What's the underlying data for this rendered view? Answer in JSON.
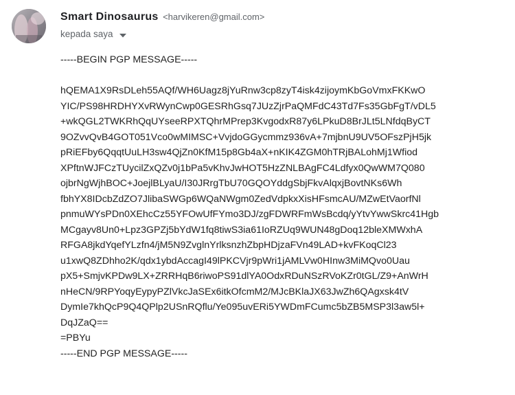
{
  "header": {
    "sender_name": "Smart Dinosaurus",
    "sender_email": "<harvikeren@gmail.com>",
    "recipient_label": "kepada saya",
    "avatar_icon": "user-photo-icon",
    "caret_icon": "caret-down-icon"
  },
  "message": {
    "begin_marker": "-----BEGIN PGP MESSAGE-----",
    "body_lines": [
      "hQEMA1X9RsDLeh55AQf/WH6Uagz8jYuRnw3cp8zyT4isk4zijoymKbGoVmxFKKwO",
      "YIC/PS98HRDHYXvRWynCwp0GESRhGsq7JUzZjrPaQMFdC43Td7Fs35GbFgT/vDL5",
      "+wkQGL2TWKRhQqUYseeRPXTQhrMPrep3KvgodxR87y6LPkuD8BrJLt5LNfdqByCT",
      "9OZvvQvB4GOT051Vco0wMIMSC+VvjdoGGycmmz936vA+7mjbnU9UV5OFszPjH5jk",
      "pRiEFby6QqqtUuLH3sw4QjZn0KfM15p8Gb4aX+nKIK4ZGM0hTRjBALohMj1Wfiod",
      "XPftnWJFCzTUycilZxQZv0j1bPa5vKhvJwHOT5HzZNLBAgFC4Ldfyx0QwWM7Q080",
      "ojbrNgWjhBOC+JoejlBLyaU/I30JRrgTbU70GQOYddgSbjFkvAlqxjBovtNKs6Wh",
      "fbhYX8IDcbZdZO7JlibaSWGp6WQaNWgm0ZedVdpkxXisHFsmcAU/MZwEtVaorfNl",
      "pnmuWYsPDn0XEhcCz55YFOwUfFYmo3DJ/zgFDWRFmWsBcdq/yYtvYwwSkrc41Hgb",
      "MCgayv8Un0+Lpz3GPZj5bYdW1fq8tiwS3ia61IoRZUq9WUN48gDoq12bleXMWxhA",
      "RFGA8jkdYqefYLzfn4/jM5N9ZvglnYrlksnzhZbpHDjzaFVn49LAD+kvFKoqCl23",
      "u1xwQ8ZDhho2K/qdx1ybdAccagI49lPKCVjr9pWri1jAMLVw0HInw3MiMQvo0Uau",
      "pX5+SmjvKPDw9LX+ZRRHqB6riwoPS91dlYA0OdxRDuNSzRVoKZr0tGL/Z9+AnWrH",
      "nHeCN/9RPYoqyEypyPZlVkcJaSEx6itkOfcmM2/MJcBKlaJX63JwZh6QAgxsk4tV",
      "DymIe7khQcP9Q4QPlp2USnRQflu/Ye095uvERi5YWDmFCumc5bZB5MSP3l3aw5l+",
      "DqJZaQ==",
      "=PBYu"
    ],
    "end_marker": "-----END PGP MESSAGE-----"
  }
}
